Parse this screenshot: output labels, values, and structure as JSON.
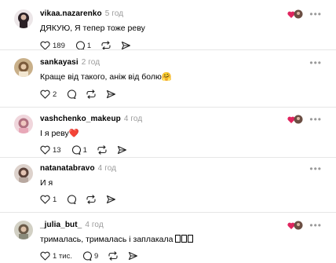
{
  "comments": [
    {
      "username": "vikaa.nazarenko",
      "time": "5 год",
      "text": "ДЯКУЮ, Я тепер тоже реву",
      "likes": "189",
      "replies": "1",
      "liked_by_author": true,
      "avatar_color": "#2a2025"
    },
    {
      "username": "sankayasi",
      "time": "2 год",
      "text": "Краще від такого, аніж від болю🤗",
      "likes": "2",
      "replies": "",
      "liked_by_author": false,
      "avatar_color": "#b59a6c"
    },
    {
      "username": "vashchenko_makeup",
      "time": "4 год",
      "text": "І я реву❤️",
      "likes": "13",
      "replies": "1",
      "liked_by_author": true,
      "avatar_color": "#c98a9a"
    },
    {
      "username": "natanatabravo",
      "time": "4 год",
      "text": "И я",
      "likes": "1",
      "replies": "",
      "liked_by_author": false,
      "avatar_color": "#a89a92"
    },
    {
      "username": "_julia_but_",
      "time": "4 год",
      "text": "трималась, трималась і заплакала ",
      "likes": "1 тис.",
      "replies": "9",
      "liked_by_author": true,
      "avatar_color": "#8a8a7a"
    }
  ],
  "colors": {
    "heart_red": "#e0245e",
    "muted": "#9a9a9a"
  }
}
